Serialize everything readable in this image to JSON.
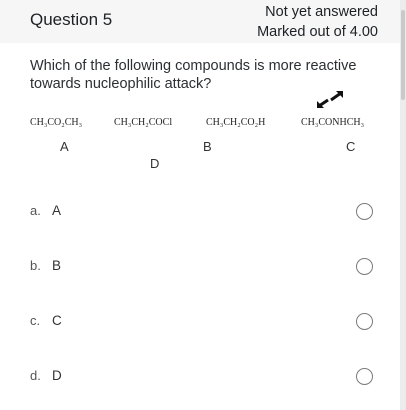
{
  "question": {
    "title": "Question 5",
    "status": "Not yet answered",
    "marks": "Marked out of 4.00",
    "text": "Which of the following compounds is more reactive towards nucleophilic attack?"
  },
  "compounds": [
    {
      "formula": "CH₃CO₂CH₃",
      "label": "A"
    },
    {
      "formula": "CH₃CH₂COCl",
      "label": "D"
    },
    {
      "formula": "CH₃CH₂CO₂H",
      "label": "B"
    },
    {
      "formula": "CH₃CONHCH₃",
      "label": "C"
    }
  ],
  "options": [
    {
      "letter": "a.",
      "text": "A"
    },
    {
      "letter": "b.",
      "text": "B"
    },
    {
      "letter": "c.",
      "text": "C"
    },
    {
      "letter": "d.",
      "text": "D"
    }
  ],
  "icons": {
    "expand": "expand-arrows-icon",
    "radio": "radio-unchecked-icon"
  },
  "colors": {
    "header_bg": "#f6f6f6",
    "card_bg": "#ffffff",
    "radio_border": "#7a7a7a"
  }
}
